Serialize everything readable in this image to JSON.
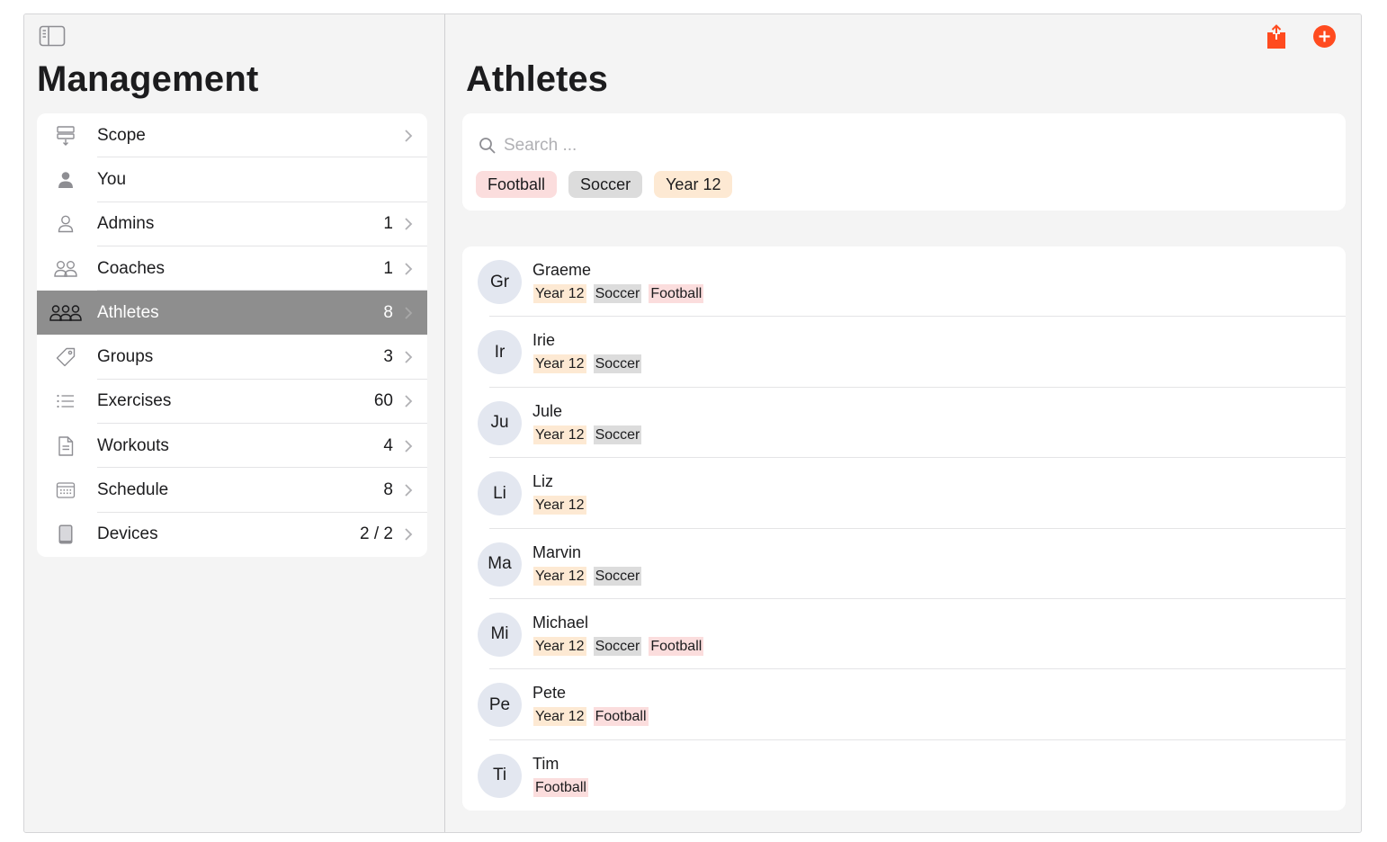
{
  "colors": {
    "accent": "#ff4b1f",
    "football": "#fbdddd",
    "soccer": "#dcdcdc",
    "year12": "#fde9d3"
  },
  "sidebar": {
    "title": "Management",
    "items": [
      {
        "label": "Scope",
        "count": "",
        "icon": "scope-icon"
      },
      {
        "label": "You",
        "count": "",
        "icon": "person-fill-icon"
      },
      {
        "label": "Admins",
        "count": "1",
        "icon": "person-icon"
      },
      {
        "label": "Coaches",
        "count": "1",
        "icon": "two-persons-icon"
      },
      {
        "label": "Athletes",
        "count": "8",
        "icon": "three-persons-icon"
      },
      {
        "label": "Groups",
        "count": "3",
        "icon": "tag-icon"
      },
      {
        "label": "Exercises",
        "count": "60",
        "icon": "list-icon"
      },
      {
        "label": "Workouts",
        "count": "4",
        "icon": "document-icon"
      },
      {
        "label": "Schedule",
        "count": "8",
        "icon": "calendar-icon"
      },
      {
        "label": "Devices",
        "count": "2 / 2",
        "icon": "tablet-icon"
      }
    ]
  },
  "main": {
    "title": "Athletes",
    "search": {
      "placeholder": "Search ...",
      "value": ""
    },
    "filters": [
      "Football",
      "Soccer",
      "Year 12"
    ],
    "athletes": [
      {
        "initials": "Gr",
        "name": "Graeme",
        "tags": [
          "Year 12",
          "Soccer",
          "Football"
        ]
      },
      {
        "initials": "Ir",
        "name": "Irie",
        "tags": [
          "Year 12",
          "Soccer"
        ]
      },
      {
        "initials": "Ju",
        "name": "Jule",
        "tags": [
          "Year 12",
          "Soccer"
        ]
      },
      {
        "initials": "Li",
        "name": "Liz",
        "tags": [
          "Year 12"
        ]
      },
      {
        "initials": "Ma",
        "name": "Marvin",
        "tags": [
          "Year 12",
          "Soccer"
        ]
      },
      {
        "initials": "Mi",
        "name": "Michael",
        "tags": [
          "Year 12",
          "Soccer",
          "Football"
        ]
      },
      {
        "initials": "Pe",
        "name": "Pete",
        "tags": [
          "Year 12",
          "Football"
        ]
      },
      {
        "initials": "Ti",
        "name": "Tim",
        "tags": [
          "Football"
        ]
      }
    ]
  }
}
